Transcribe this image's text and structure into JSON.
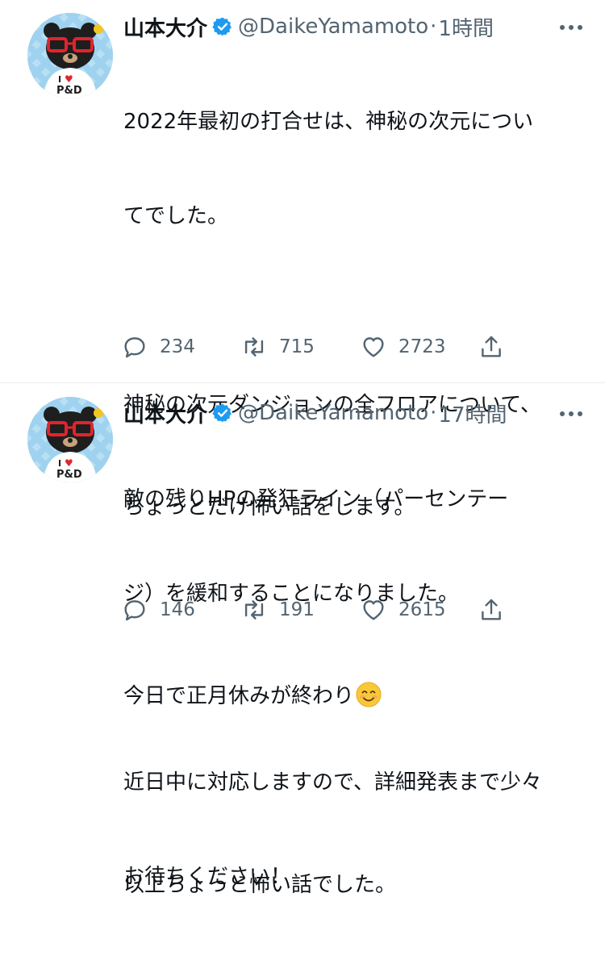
{
  "tweets": [
    {
      "display_name": "山本大介",
      "handle": "@DaikeYamamoto",
      "separator": "·",
      "time": "1時間",
      "lines": [
        "2022年最初の打合せは、神秘の次元につい",
        "てでした。",
        "",
        "神秘の次元ダンジョンの全フロアについて、",
        "敵の残りHPの発狂ライン（パーセンテー",
        "ジ）を緩和することになりました。",
        "",
        "近日中に対応しますので、詳細発表まで少々",
        "お待ちください！"
      ],
      "replies": "234",
      "retweets": "715",
      "likes": "2723",
      "avatar_badge": "I ♥ P&D"
    },
    {
      "display_name": "山本大介",
      "handle": "@DaikeYamamoto",
      "separator": "·",
      "time": "17時間",
      "lines": [
        "ちょっとだけ怖い話をします。",
        "",
        "今日で正月休みが終わり",
        "",
        "以上ちょっと怖い話でした。"
      ],
      "emoji": "smiling-face",
      "replies": "146",
      "retweets": "191",
      "likes": "2615",
      "avatar_badge": "I ♥ P&D"
    }
  ],
  "colors": {
    "text": "#0f1419",
    "secondary": "#536471",
    "verified": "#1d9bf0",
    "divider": "#e6ecf0",
    "avatar_bg": "#9fd2ee",
    "glasses": "#e0242c"
  }
}
